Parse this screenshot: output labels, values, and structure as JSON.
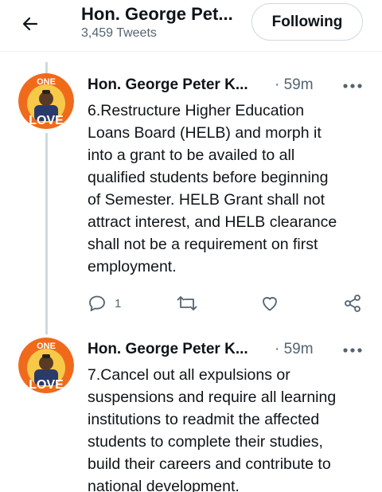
{
  "header": {
    "back_icon": "arrow-left-icon",
    "title": "Hon. George Pet...",
    "tweet_count": "3,459 Tweets",
    "follow_button": "Following"
  },
  "tweets": [
    {
      "author": "Hon. George Peter K...",
      "time": "· 59m",
      "avatar_text_top": "ONE",
      "avatar_text_bottom": "LOVE",
      "text": "6.Restructure Higher Education\nLoans Board (HELB) and morph it\ninto a grant to be availed to all\nqualified students before beginning\nof Semester. HELB Grant shall not\nattract interest, and HELB clearance\nshall not be a requirement on first\nemployment.",
      "reply_count": "1"
    },
    {
      "author": "Hon. George Peter K...",
      "time": "· 59m",
      "avatar_text_top": "ONE",
      "avatar_text_bottom": "LOVE",
      "text": "7.Cancel out all expulsions or\nsuspensions and require all learning\ninstitutions to readmit the affected\nstudents to complete their studies,\nbuild their careers and contribute to\nnational development."
    }
  ],
  "colors": {
    "text": "#0f1419",
    "secondary": "#536471",
    "border": "#cfd9de",
    "avatar_orange": "#f06a1c",
    "avatar_yellow": "#f7c948"
  }
}
